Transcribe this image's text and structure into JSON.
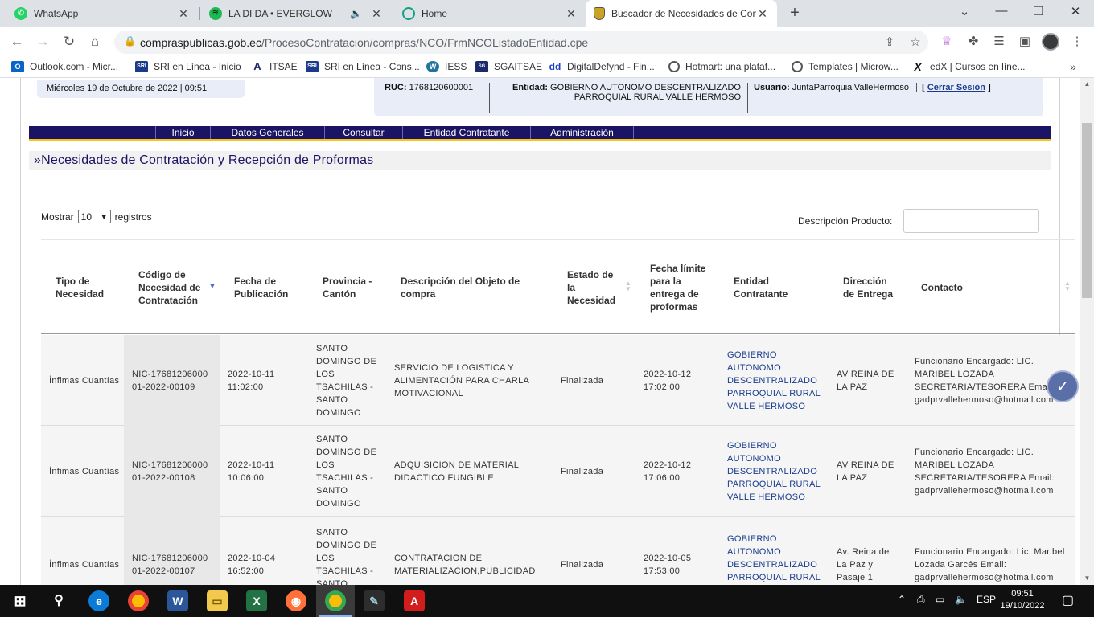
{
  "browser": {
    "tabs": [
      {
        "title": "WhatsApp",
        "icon": "whatsapp-icon",
        "color": "#25d366"
      },
      {
        "title": "LA DI DA • EVERGLOW",
        "icon": "spotify-icon",
        "color": "#1db954"
      },
      {
        "title": "Home",
        "icon": "chatgpt-icon",
        "color": "#10a37f"
      },
      {
        "title": "Buscador de Necesidades de Con",
        "icon": "ecuador-shield-icon",
        "color": "#c9a227"
      }
    ],
    "url_host": "compraspublicas.gob.ec",
    "url_path": "/ProcesoContratacion/compras/NCO/FrmNCOListadoEntidad.cpe",
    "bookmarks": [
      {
        "label": "Outlook.com - Micr...",
        "icon_color": "#0a64c8",
        "icon_text": "O"
      },
      {
        "label": "SRI en Línea - Inicio",
        "icon_color": "#1b3a8c",
        "icon_text": "SRI"
      },
      {
        "label": "ITSAE",
        "icon_color": "#1b2a6b",
        "icon_text": "A"
      },
      {
        "label": "SRI en Línea - Cons...",
        "icon_color": "#1b3a8c",
        "icon_text": "SRI"
      },
      {
        "label": "IESS",
        "icon_color": "#21759b",
        "icon_text": "W"
      },
      {
        "label": "SGAITSAE",
        "icon_color": "#1b2a6b",
        "icon_text": "SG"
      },
      {
        "label": "DigitalDefynd - Fin...",
        "icon_color": "#1e40c8",
        "icon_text": "dd"
      },
      {
        "label": "Hotmart: una plataf...",
        "icon_color": "#555555",
        "icon_text": "H"
      },
      {
        "label": "Templates | Microw...",
        "icon_color": "#555555",
        "icon_text": "T"
      },
      {
        "label": "edX | Cursos en líne...",
        "icon_color": "#111111",
        "icon_text": "X"
      }
    ]
  },
  "header": {
    "date": "Miércoles 19 de Octubre de 2022 | 09:51",
    "ruc_label": "RUC:",
    "ruc_value": "1768120600001",
    "entidad_label": "Entidad:",
    "entidad_value": "GOBIERNO AUTONOMO DESCENTRALIZADO PARROQUIAL RURAL VALLE HERMOSO",
    "usuario_label": "Usuario:",
    "usuario_value": "JuntaParroquialValleHermoso",
    "logout_open": "[ ",
    "logout_label": "Cerrar Sesión",
    "logout_close": " ]"
  },
  "menu": [
    "Inicio",
    "Datos Generales",
    "Consultar",
    "Entidad Contratante",
    "Administración"
  ],
  "section_title": "»Necesidades de Contratación y Recepción de Proformas",
  "controls": {
    "show_label": "Mostrar",
    "show_value": "10",
    "records_label": "registros",
    "filter_label": "Descripción Producto:",
    "filter_value": ""
  },
  "table": {
    "headers": [
      "Tipo de Necesidad",
      "Código de Necesidad de Contratación",
      "Fecha de Publicación",
      "Provincia - Cantón",
      "Descripción del Objeto de compra",
      "Estado de la Necesidad",
      "Fecha límite para la entrega de proformas",
      "Entidad Contratante",
      "Dirección de Entrega",
      "Contacto"
    ],
    "rows": [
      {
        "tipo": "Ínfimas Cuantías",
        "codigo": "NIC-1768120600001-2022-00109",
        "fecha": "2022-10-11 11:02:00",
        "provincia": "SANTO DOMINGO DE LOS TSACHILAS - SANTO DOMINGO",
        "descripcion": "SERVICIO DE LOGISTICA Y ALIMENTACIÓN PARA CHARLA MOTIVACIONAL",
        "estado": "Finalizada",
        "fecha_limite": "2022-10-12 17:02:00",
        "entidad": "GOBIERNO AUTONOMO DESCENTRALIZADO PARROQUIAL RURAL VALLE HERMOSO",
        "direccion": "AV REINA DE LA PAZ",
        "contacto": "Funcionario Encargado: LIC. MARIBEL LOZADA SECRETARIA/TESORERA Email: gadprvallehermoso@hotmail.com"
      },
      {
        "tipo": "Ínfimas Cuantías",
        "codigo": "NIC-1768120600001-2022-00108",
        "fecha": "2022-10-11 10:06:00",
        "provincia": "SANTO DOMINGO DE LOS TSACHILAS - SANTO DOMINGO",
        "descripcion": "ADQUISICION DE MATERIAL DIDACTICO FUNGIBLE",
        "estado": "Finalizada",
        "fecha_limite": "2022-10-12 17:06:00",
        "entidad": "GOBIERNO AUTONOMO DESCENTRALIZADO PARROQUIAL RURAL VALLE HERMOSO",
        "direccion": "AV REINA DE LA PAZ",
        "contacto": "Funcionario Encargado: LIC. MARIBEL LOZADA SECRETARIA/TESORERA Email: gadprvallehermoso@hotmail.com"
      },
      {
        "tipo": "Ínfimas Cuantías",
        "codigo": "NIC-1768120600001-2022-00107",
        "fecha": "2022-10-04 16:52:00",
        "provincia": "SANTO DOMINGO DE LOS TSACHILAS - SANTO DOMINGO",
        "descripcion": "CONTRATACION DE MATERIALIZACION,PUBLICIDAD",
        "estado": "Finalizada",
        "fecha_limite": "2022-10-05 17:53:00",
        "entidad": "GOBIERNO AUTONOMO DESCENTRALIZADO PARROQUIAL RURAL VALLE HERMOSO",
        "direccion": "Av. Reina de La Paz y Pasaje 1",
        "contacto": "Funcionario Encargado: Lic. Maribel Lozada Garcés Email: gadprvallehermoso@hotmail.com"
      }
    ]
  },
  "taskbar": {
    "language": "ESP",
    "time": "09:51",
    "date": "19/10/2022"
  }
}
